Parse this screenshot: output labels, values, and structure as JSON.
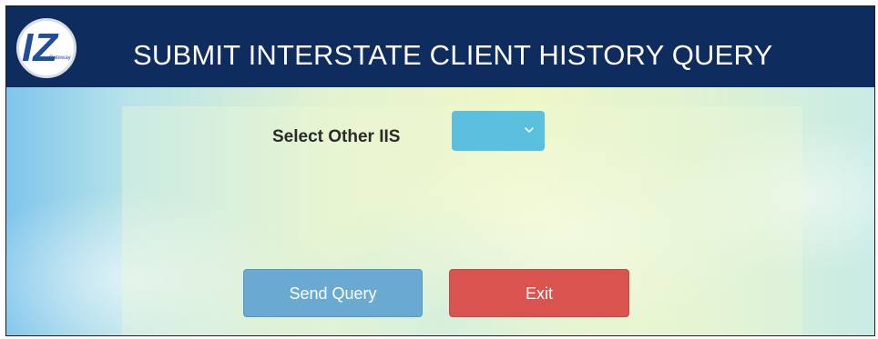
{
  "header": {
    "title": "SUBMIT INTERSTATE CLIENT HISTORY QUERY",
    "logo": {
      "mark": "IZ",
      "subtext": "Gateway",
      "colors": {
        "mark": "#1f4e9c",
        "ring": "#d8dde6"
      }
    },
    "background_color": "#0f2c5e"
  },
  "form": {
    "select_label": "Select Other IIS",
    "select": {
      "selected_value": "",
      "icon": "chevron-down-icon",
      "color": "#5bc0de"
    }
  },
  "actions": {
    "send_label": "Send Query",
    "send_color": "#6aa9d1",
    "exit_label": "Exit",
    "exit_color": "#d9534f"
  }
}
